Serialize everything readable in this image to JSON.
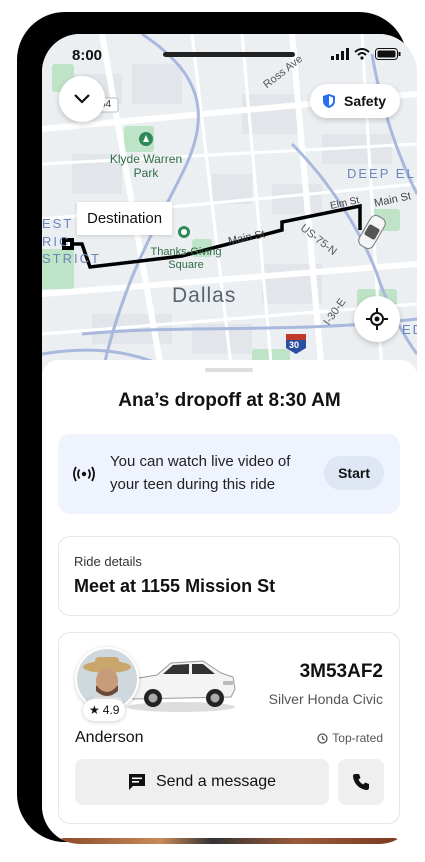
{
  "status_bar": {
    "time": "8:00"
  },
  "map": {
    "safety_label": "Safety",
    "destination_label": "Destination",
    "city_label": "Dallas",
    "park_label": "Klyde Warren Park",
    "square_label": "Thanks-Giving Square",
    "district_labels": [
      "EST",
      "RIC",
      "STRICT"
    ],
    "deep_ellum_label": "DEEP EL",
    "ed_label": "ED",
    "streets": [
      "Ross Ave",
      "Main St",
      "Elm St",
      "Main St",
      "US-75-N",
      "I-30-E"
    ],
    "shields": [
      "54",
      "30"
    ]
  },
  "sheet": {
    "headline": "Ana’s dropoff at 8:30 AM",
    "video": {
      "text": "You can watch live video of your teen during this ride",
      "start_label": "Start"
    },
    "ride_details": {
      "label": "Ride details",
      "value": "Meet at 1155 Mission St"
    },
    "driver": {
      "rating": "4.9",
      "plate": "3M53AF2",
      "vehicle": "Silver Honda Civic",
      "name": "Anderson",
      "badge": "Top-rated",
      "message_label": "Send a message"
    }
  },
  "colors": {
    "route": "#000000",
    "video_card_bg": "#eef3fd",
    "safety_shield": "#276ef1",
    "park_green": "#bfe3c6"
  }
}
